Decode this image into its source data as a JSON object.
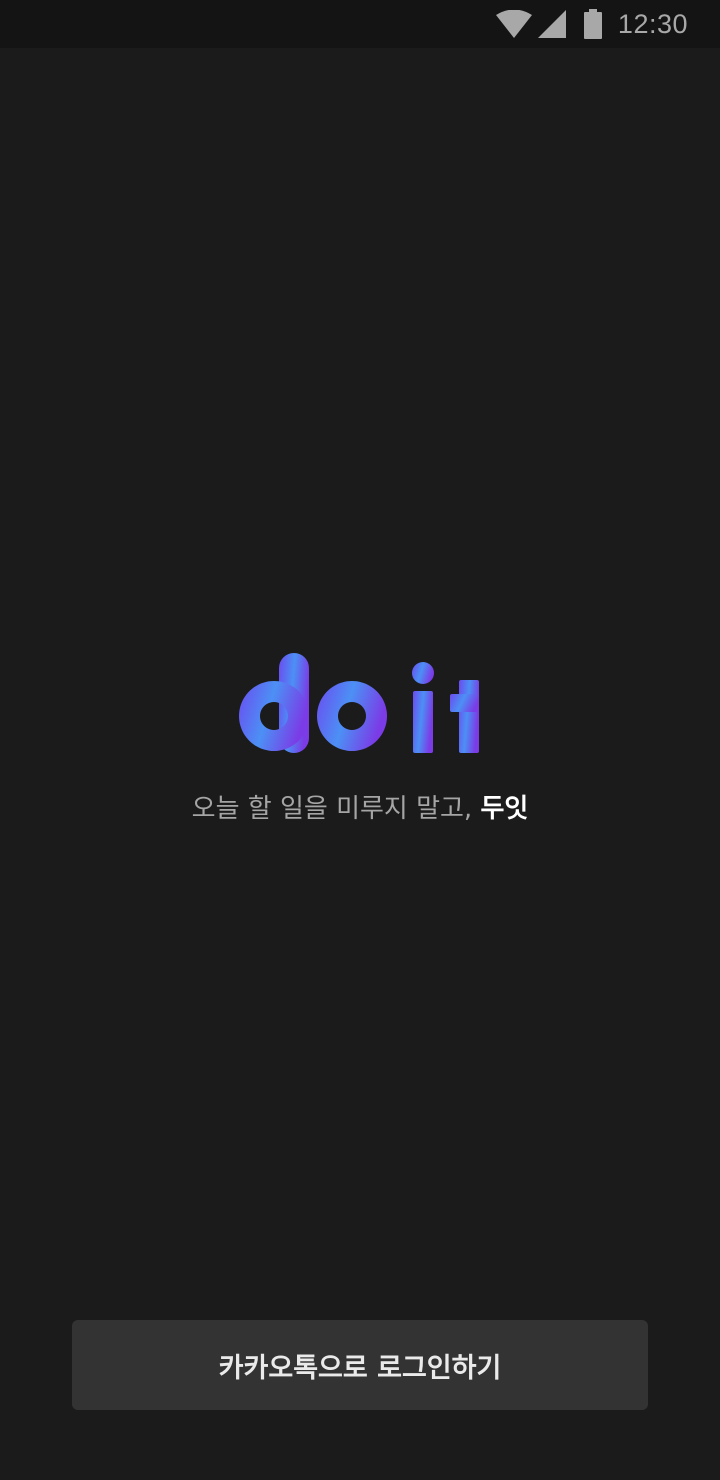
{
  "status_bar": {
    "time": "12:30",
    "icons": [
      "wifi-icon",
      "cell-signal-icon",
      "battery-icon"
    ]
  },
  "splash": {
    "logo_text": "do it",
    "tagline_prefix": "오늘 할 일을 미루지 말고, ",
    "tagline_brand": "두잇"
  },
  "login": {
    "kakao_label": "카카오톡으로 로그인하기"
  },
  "colors": {
    "background": "#1b1b1b",
    "status_bar": "#141414",
    "button": "#333333",
    "logo_gradient_start": "#6a4cf0",
    "logo_gradient_mid": "#4d8ff5",
    "logo_gradient_end": "#7a3de6"
  }
}
